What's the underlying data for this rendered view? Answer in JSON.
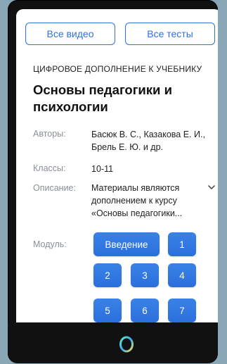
{
  "header": {
    "all_videos_label": "Все видео",
    "all_tests_label": "Все тесты"
  },
  "course": {
    "subtitle": "ЦИФРОВОЕ ДОПОЛНЕНИЕ К УЧЕБНИКУ",
    "title": "Основы педагогики и психологии"
  },
  "meta": {
    "authors_label": "Авторы:",
    "authors_value": "Басюк В. С., Казакова Е. И., Брель Е. Ю. и др.",
    "grades_label": "Классы:",
    "grades_value": "10-11",
    "description_label": "Описание:",
    "description_value": "Материалы являются дополнением к курсу «Основы педагогики...",
    "module_label": "Модуль:"
  },
  "modules": [
    "Введение",
    "1",
    "2",
    "3",
    "4",
    "5",
    "6",
    "7"
  ],
  "icons": {
    "expand": "chevron-down-icon",
    "home": "home-ring-icon"
  },
  "colors": {
    "accent": "#2f72db",
    "module_button": "#3a82e6",
    "background": "#8aa7b7",
    "device": "#111111"
  }
}
